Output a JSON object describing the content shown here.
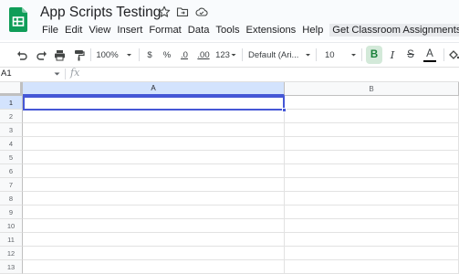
{
  "doc": {
    "title": "App Scripts Testing"
  },
  "menu": [
    "File",
    "Edit",
    "View",
    "Insert",
    "Format",
    "Data",
    "Tools",
    "Extensions",
    "Help",
    "Get Classroom Assignments"
  ],
  "toolbar": {
    "zoom": "100%",
    "currency": "$",
    "percent": "%",
    "decrease_decimal": ".0",
    "increase_decimal": ".00",
    "more_formats": "123",
    "font": "Default (Ari...",
    "font_size": "10",
    "bold": "B",
    "italic": "I",
    "strike": "S",
    "text_color": "A"
  },
  "formula_bar": {
    "name_box": "A1",
    "fx": "fx",
    "value": ""
  },
  "grid": {
    "columns": [
      "A",
      "B"
    ],
    "rows": [
      "1",
      "2",
      "3",
      "4",
      "5",
      "6",
      "7",
      "8",
      "9",
      "10",
      "11",
      "12",
      "13"
    ],
    "active_cell": "A1"
  },
  "colors": {
    "accent": "#4557d6",
    "sheets_green": "#0f9d58",
    "header_bg": "#f8f9fa"
  }
}
